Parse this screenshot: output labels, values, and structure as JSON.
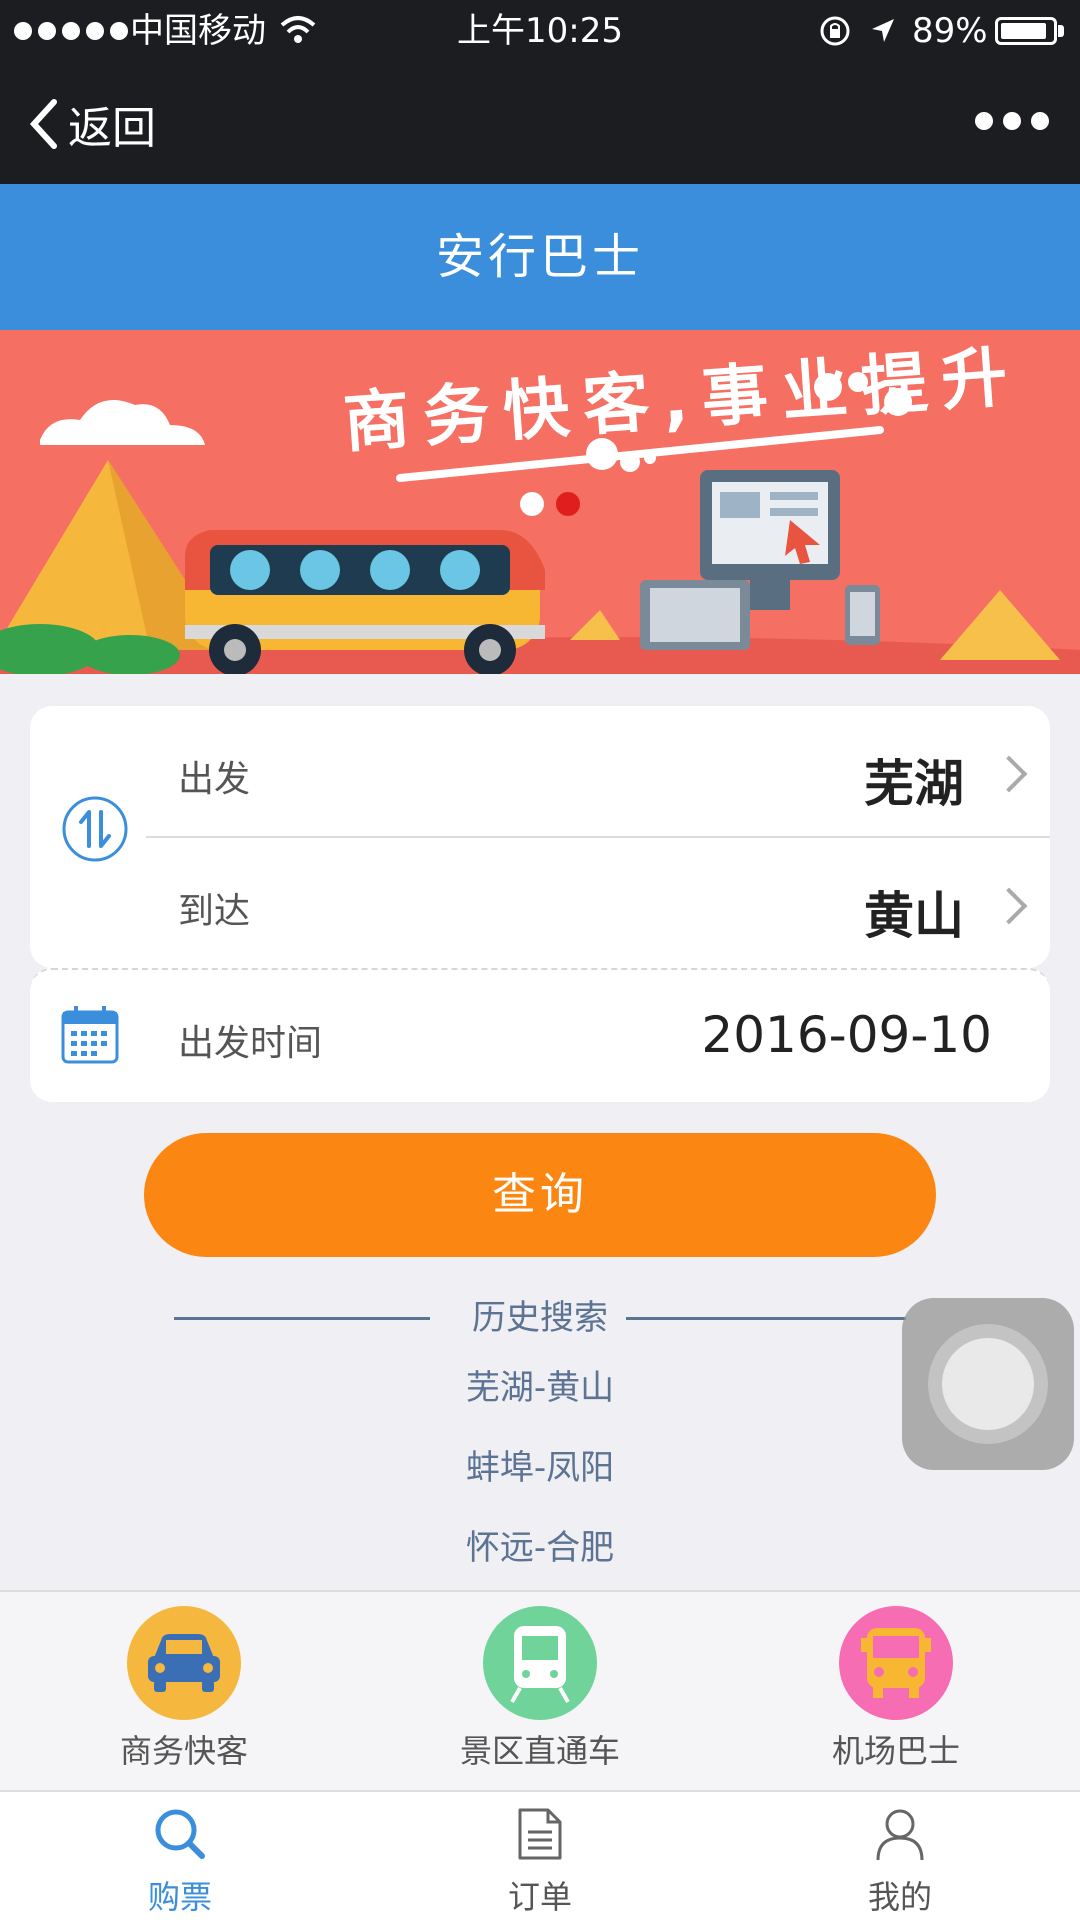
{
  "status_bar": {
    "carrier": "中国移动",
    "time": "上午10:25",
    "battery": "89%",
    "battery_level": 0.89
  },
  "nav_bar": {
    "back_label": "返回"
  },
  "header": {
    "title": "安行巴士"
  },
  "banner": {
    "slogan": "商务快客,事业提升",
    "active_slide": 2,
    "slide_count": 2
  },
  "route_form": {
    "depart_label": "出发",
    "depart_value": "芜湖",
    "arrive_label": "到达",
    "arrive_value": "黄山",
    "date_label": "出发时间",
    "date_value": "2016-09-10"
  },
  "search_button": {
    "label": "查询"
  },
  "history": {
    "title": "历史搜索",
    "items": [
      "芜湖-黄山",
      "蚌埠-凤阳",
      "怀远-合肥"
    ]
  },
  "services": [
    {
      "label": "商务快客",
      "icon": "car-icon",
      "color": "#f5b73d"
    },
    {
      "label": "景区直通车",
      "icon": "train-icon",
      "color": "#6fd39a"
    },
    {
      "label": "机场巴士",
      "icon": "bus-icon",
      "color": "#f76db3"
    }
  ],
  "tabs": [
    {
      "label": "购票",
      "icon": "search-icon",
      "active": true
    },
    {
      "label": "订单",
      "icon": "document-icon",
      "active": false
    },
    {
      "label": "我的",
      "icon": "user-icon",
      "active": false
    }
  ],
  "colors": {
    "header_blue": "#3b8edb",
    "accent_orange": "#fb8712",
    "tab_active": "#3b8edb",
    "banner_bg": "#f56f62"
  }
}
